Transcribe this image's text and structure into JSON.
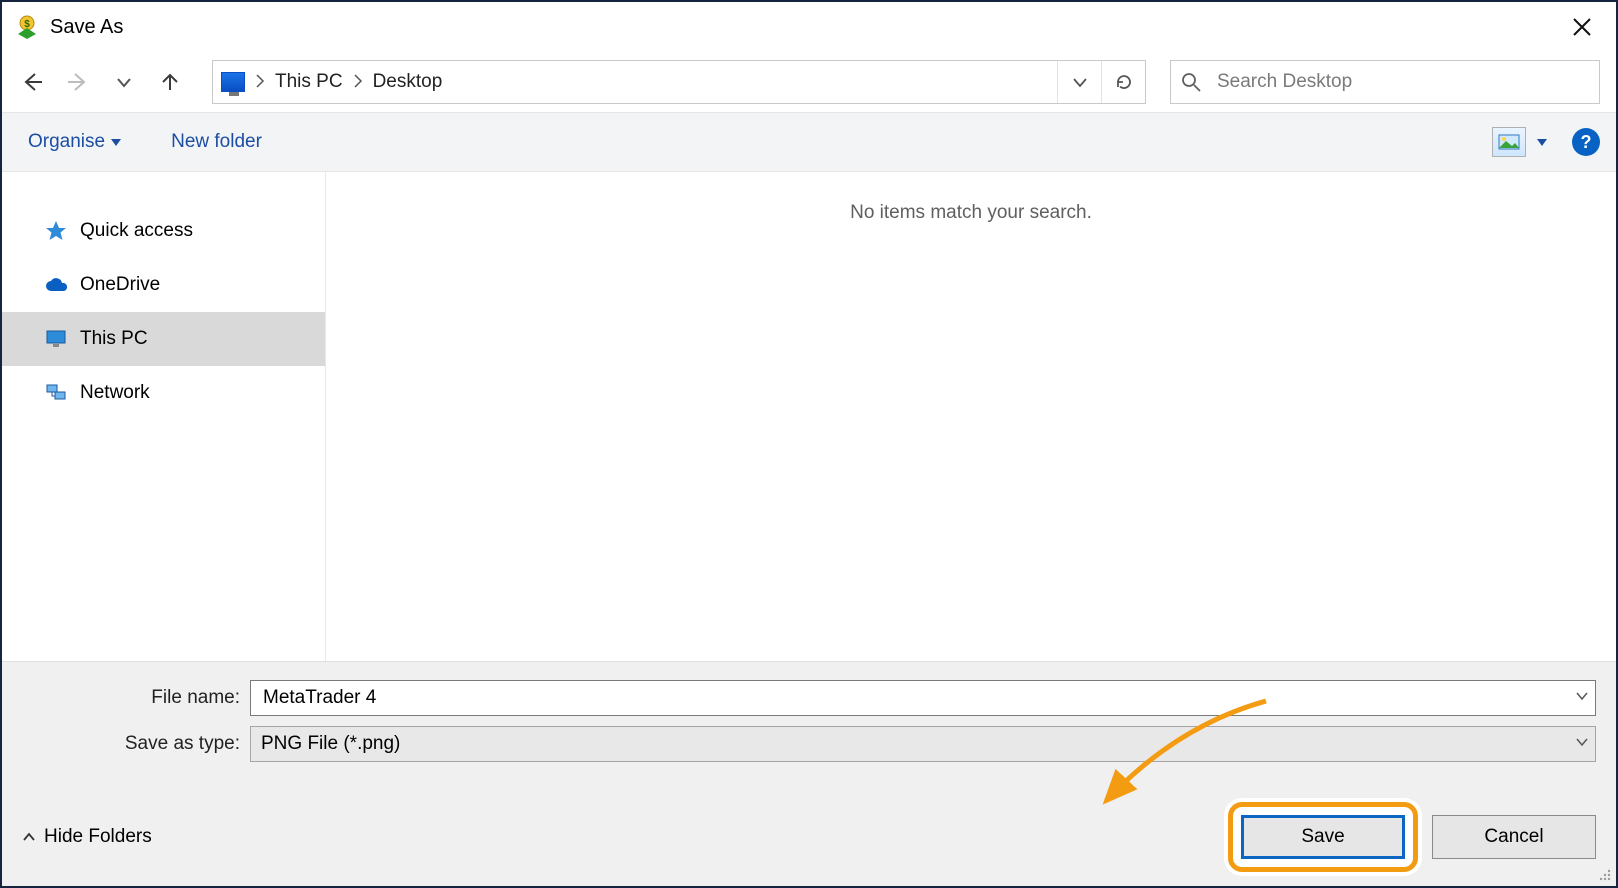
{
  "window": {
    "title": "Save As"
  },
  "nav": {
    "path_root": "This PC",
    "path_leaf": "Desktop",
    "search_placeholder": "Search Desktop"
  },
  "cmdbar": {
    "organise": "Organise",
    "new_folder": "New folder"
  },
  "sidebar": {
    "items": [
      {
        "label": "Quick access"
      },
      {
        "label": "OneDrive"
      },
      {
        "label": "This PC"
      },
      {
        "label": "Network"
      }
    ]
  },
  "content": {
    "empty": "No items match your search."
  },
  "fields": {
    "filename_label": "File name:",
    "filename_value": "MetaTrader 4",
    "type_label": "Save as type:",
    "type_value": "PNG File (*.png)"
  },
  "buttons": {
    "hide_folders": "Hide Folders",
    "save": "Save",
    "cancel": "Cancel"
  }
}
